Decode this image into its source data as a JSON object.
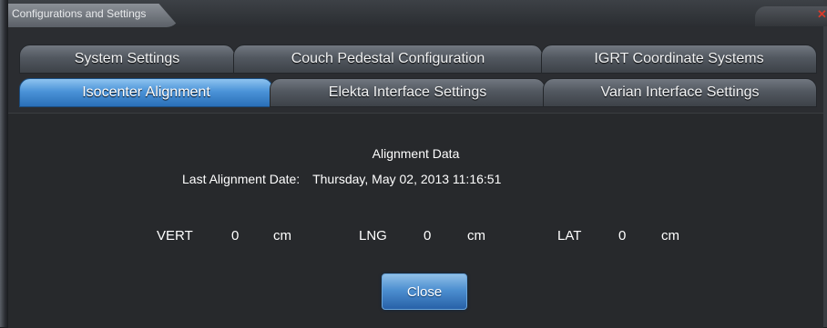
{
  "window": {
    "title": "Configurations and Settings"
  },
  "tabs": {
    "row1": [
      {
        "label": "System Settings"
      },
      {
        "label": "Couch Pedestal Configuration"
      },
      {
        "label": "IGRT Coordinate Systems"
      }
    ],
    "row2": [
      {
        "label": "Isocenter Alignment",
        "active": true
      },
      {
        "label": "Elekta Interface Settings"
      },
      {
        "label": "Varian Interface Settings"
      }
    ]
  },
  "alignment": {
    "heading": "Alignment Data",
    "last_date_label": "Last Alignment Date:",
    "last_date_value": "Thursday, May 02, 2013 11:16:51",
    "vert": {
      "label": "VERT",
      "value": "0",
      "unit": "cm"
    },
    "lng": {
      "label": "LNG",
      "value": "0",
      "unit": "cm"
    },
    "lat": {
      "label": "LAT",
      "value": "0",
      "unit": "cm"
    }
  },
  "buttons": {
    "close": "Close"
  },
  "colors": {
    "active_tab": "#4b93d8",
    "inactive_tab": "#525860",
    "panel_bg": "#27292c"
  }
}
